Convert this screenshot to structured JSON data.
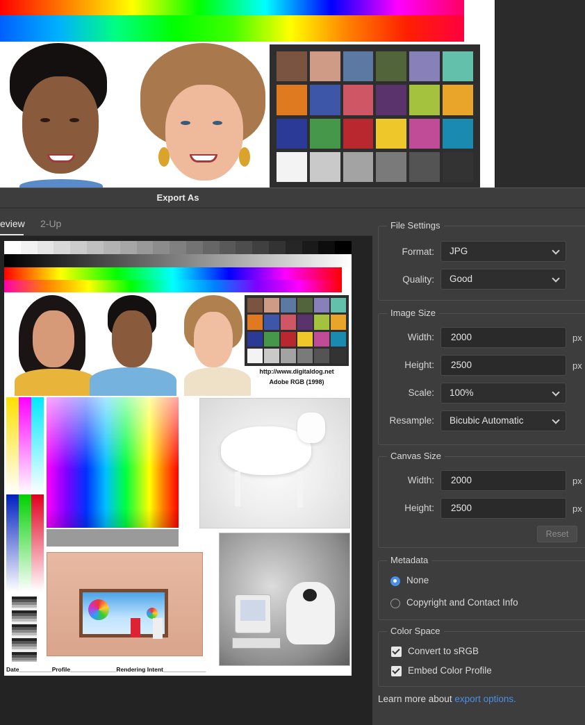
{
  "dialog": {
    "title": "Export As",
    "tabs": [
      {
        "label": "eview",
        "active": true
      },
      {
        "label": "2-Up",
        "active": false
      }
    ]
  },
  "preview": {
    "url_text": "http://www.digitaldog.net",
    "profile_text": "Adobe RGB (1998)",
    "footer_text": "Date__________Profile______________Rendering Intent_____________"
  },
  "file_settings": {
    "title": "File Settings",
    "format_label": "Format:",
    "format_value": "JPG",
    "quality_label": "Quality:",
    "quality_value": "Good"
  },
  "image_size": {
    "title": "Image Size",
    "width_label": "Width:",
    "width_value": "2000",
    "height_label": "Height:",
    "height_value": "2500",
    "unit": "px",
    "scale_label": "Scale:",
    "scale_value": "100%",
    "resample_label": "Resample:",
    "resample_value": "Bicubic Automatic"
  },
  "canvas_size": {
    "title": "Canvas Size",
    "width_label": "Width:",
    "width_value": "2000",
    "height_label": "Height:",
    "height_value": "2500",
    "unit": "px",
    "reset_label": "Reset"
  },
  "metadata": {
    "title": "Metadata",
    "options": [
      {
        "label": "None",
        "selected": true
      },
      {
        "label": "Copyright and Contact Info",
        "selected": false
      }
    ]
  },
  "color_space": {
    "title": "Color Space",
    "options": [
      {
        "label": "Convert to sRGB",
        "checked": true
      },
      {
        "label": "Embed Color Profile",
        "checked": true
      }
    ]
  },
  "learn_more": {
    "prefix": "Learn more about ",
    "link": "export options."
  },
  "colors": {
    "accent": "#4b8fe6",
    "panel_bg": "#3d3d3d",
    "preview_bg": "#232323"
  },
  "checker_colors": [
    "#7a5441",
    "#cf9a86",
    "#5b79a3",
    "#52643a",
    "#8880b8",
    "#63c0ab",
    "#e07a20",
    "#3d56a8",
    "#cf5665",
    "#5a336c",
    "#a4c23d",
    "#e9a52a",
    "#2a3a96",
    "#46974a",
    "#b8282e",
    "#eec82a",
    "#c04c98",
    "#1a8ab0",
    "#f3f3f3",
    "#c9c9c9",
    "#a3a3a3",
    "#7a7a7a",
    "#545454",
    "#333333"
  ]
}
